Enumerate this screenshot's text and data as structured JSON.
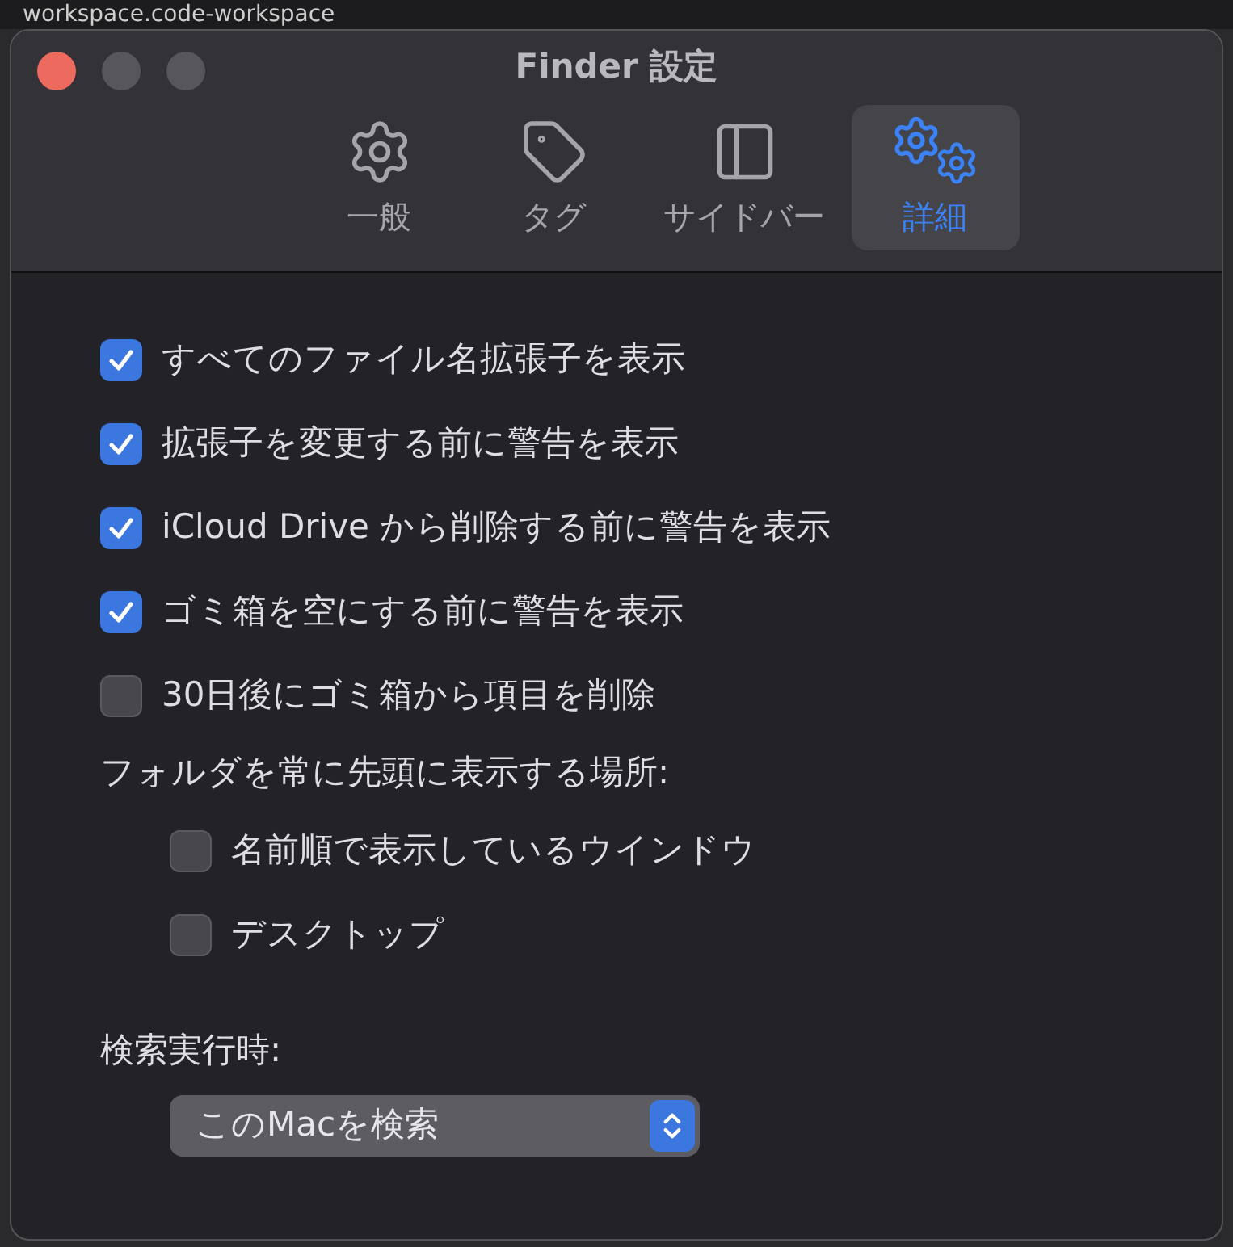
{
  "background_text": "workspace.code-workspace",
  "window": {
    "title": "Finder 設定"
  },
  "tabs": [
    {
      "kind": "gear",
      "label": "一般",
      "selected": false
    },
    {
      "kind": "tag",
      "label": "タグ",
      "selected": false
    },
    {
      "kind": "sidebar",
      "label": "サイドバー",
      "selected": false
    },
    {
      "kind": "gears",
      "label": "詳細",
      "selected": true
    }
  ],
  "options": [
    {
      "label": "すべてのファイル名拡張子を表示",
      "checked": true
    },
    {
      "label": "拡張子を変更する前に警告を表示",
      "checked": true
    },
    {
      "label": "iCloud Drive から削除する前に警告を表示",
      "checked": true
    },
    {
      "label": "ゴミ箱を空にする前に警告を表示",
      "checked": true
    },
    {
      "label": "30日後にゴミ箱から項目を削除",
      "checked": false
    }
  ],
  "folders_section": {
    "label": "フォルダを常に先頭に表示する場所:",
    "options": [
      {
        "label": "名前順で表示しているウインドウ",
        "checked": false
      },
      {
        "label": "デスクトップ",
        "checked": false
      }
    ]
  },
  "search_section": {
    "label": "検索実行時:",
    "value": "このMacを検索"
  }
}
